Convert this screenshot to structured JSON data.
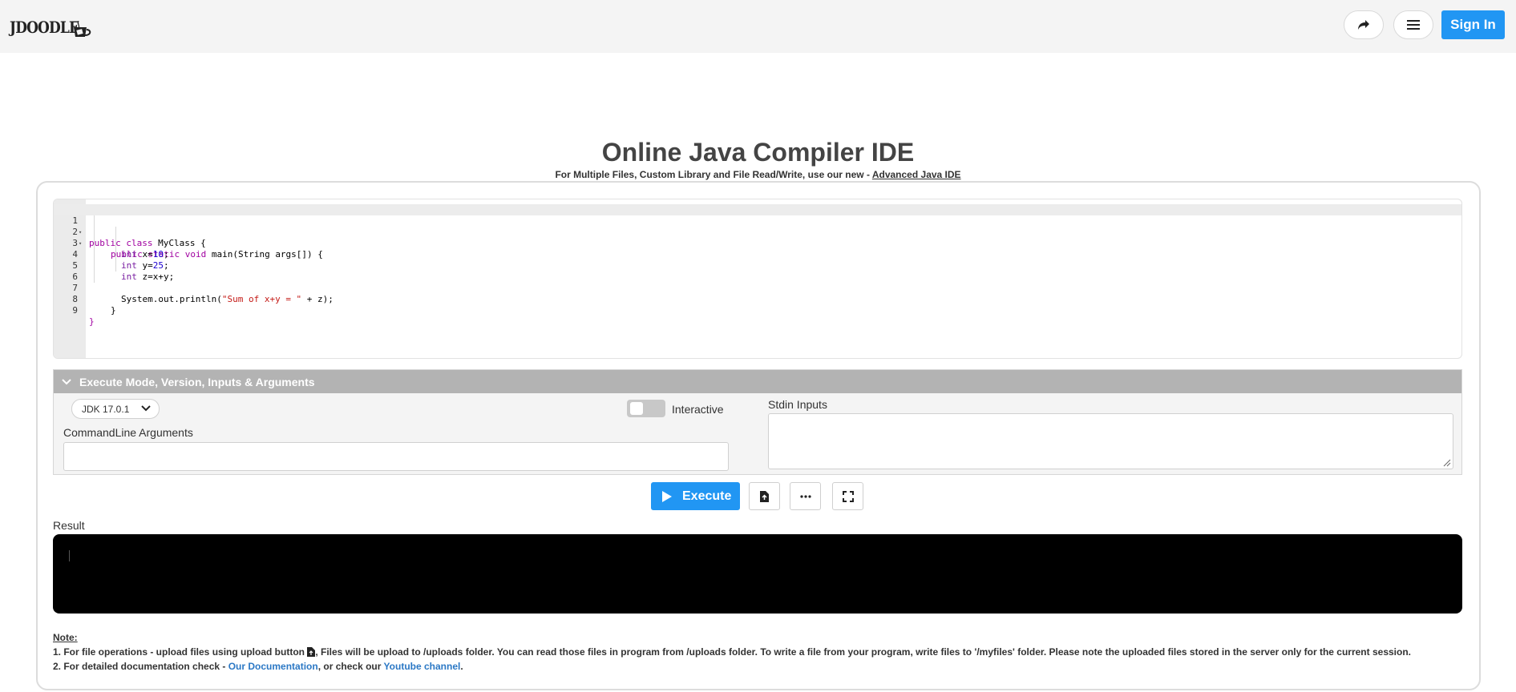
{
  "header": {
    "logo_text": "JDOODLE",
    "signin_label": "Sign In"
  },
  "page": {
    "title": "Online Java Compiler IDE",
    "subtitle_prefix": "For Multiple Files, Custom Library and File Read/Write, use our new - ",
    "subtitle_link": "Advanced Java IDE"
  },
  "editor": {
    "lines": [
      {
        "num": "1",
        "fold": true
      },
      {
        "num": "2",
        "fold": true
      },
      {
        "num": "3",
        "fold": false
      },
      {
        "num": "4",
        "fold": false
      },
      {
        "num": "5",
        "fold": false
      },
      {
        "num": "6",
        "fold": false
      },
      {
        "num": "7",
        "fold": false
      },
      {
        "num": "8",
        "fold": false
      },
      {
        "num": "9",
        "fold": false
      }
    ],
    "code": {
      "l1_kw": "public class ",
      "l1_rest": "MyClass {",
      "l2_kw": "public static void ",
      "l2_rest": "main(String args[]) {",
      "l3_type": "int ",
      "l3_rest": "x=",
      "l3_num": "10",
      "l3_end": ";",
      "l4_type": "int ",
      "l4_rest": "y=",
      "l4_num": "25",
      "l4_end": ";",
      "l5_type": "int ",
      "l5_rest": "z=x+y;",
      "l7_pre": "System.out.println(",
      "l7_str": "\"Sum of x+y = \"",
      "l7_end": " + z);",
      "l8": "}",
      "l9": "}"
    }
  },
  "options": {
    "header_label": "Execute Mode, Version, Inputs & Arguments",
    "jdk_selected": "JDK 17.0.1",
    "interactive_label": "Interactive",
    "interactive_on": false,
    "cmd_label": "CommandLine Arguments",
    "cmd_value": "",
    "stdin_label": "Stdin Inputs",
    "stdin_value": ""
  },
  "actions": {
    "execute_label": "Execute"
  },
  "result": {
    "label": "Result",
    "output": ""
  },
  "notes": {
    "title": "Note:",
    "line1_a": "1. For file operations - upload files using upload button ",
    "line1_b": ", Files will be upload to /uploads folder. You can read those files in program from /uploads folder. To write a file from your program, write files to '/myfiles' folder. Please note the uploaded files stored in the server only for the current session.",
    "line2_a": "2. For detailed documentation check - ",
    "line2_link1": "Our Documentation",
    "line2_b": ", or check our ",
    "line2_link2": "Youtube channel",
    "line2_c": "."
  },
  "colors": {
    "accent": "#2196f3",
    "panel_header": "#b3b3b3",
    "link": "#2b78c5",
    "result_bg": "#000000"
  },
  "icons": [
    "share-icon",
    "hamburger-menu-icon",
    "chevron-down-icon",
    "play-icon",
    "upload-file-icon",
    "more-dots-icon",
    "fullscreen-icon",
    "resize-handle-icon"
  ]
}
